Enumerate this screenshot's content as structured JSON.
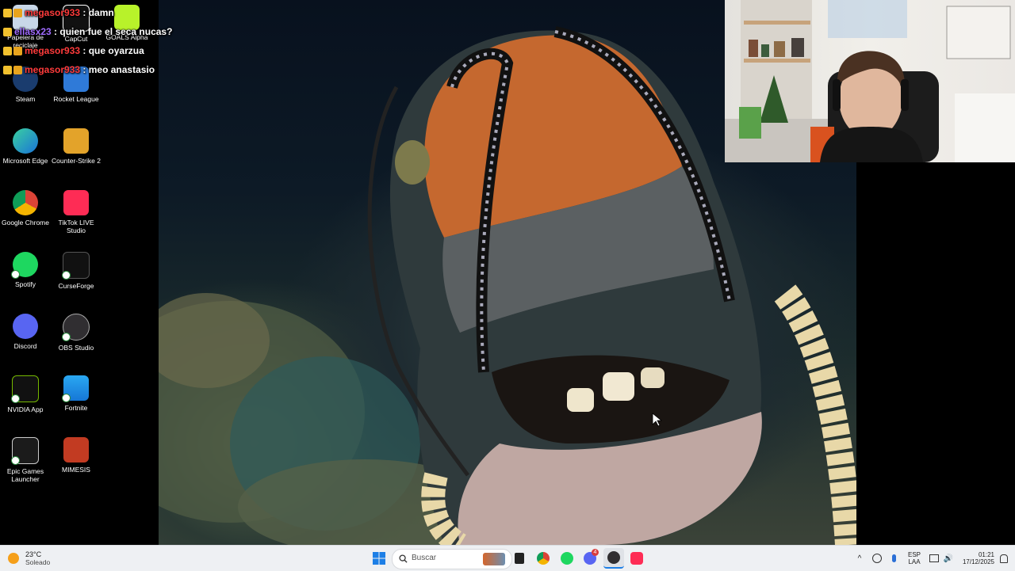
{
  "chat": [
    {
      "user": "megasor933",
      "message": "damn",
      "user_color": "#ff3b3b"
    },
    {
      "user": "ellasx23",
      "message": "quien fue el seca nucas?",
      "user_color": "#a06bff"
    },
    {
      "user": "megasor933",
      "message": "que oyarzua",
      "user_color": "#ff3b3b"
    },
    {
      "user": "megasor933",
      "message": "meo anastasio",
      "user_color": "#ff3b3b"
    }
  ],
  "desktop_icons": [
    {
      "label": "Papelera de reciclaje",
      "icon": "recycle-bin-icon"
    },
    {
      "label": "CapCut",
      "icon": "capcut-icon"
    },
    {
      "label": "GOALS Alpha",
      "icon": "goals-icon"
    },
    {
      "label": "Steam",
      "icon": "steam-icon"
    },
    {
      "label": "Rocket League",
      "icon": "rocket-league-icon"
    },
    {
      "label": "Microsoft Edge",
      "icon": "edge-icon"
    },
    {
      "label": "Counter-Strike 2",
      "icon": "counter-strike-icon"
    },
    {
      "label": "Google Chrome",
      "icon": "chrome-icon"
    },
    {
      "label": "TikTok LIVE Studio",
      "icon": "tiktok-icon"
    },
    {
      "label": "Spotify",
      "icon": "spotify-icon"
    },
    {
      "label": "CurseForge",
      "icon": "curseforge-icon"
    },
    {
      "label": "Discord",
      "icon": "discord-icon"
    },
    {
      "label": "OBS Studio",
      "icon": "obs-icon"
    },
    {
      "label": "NVIDIA App",
      "icon": "nvidia-icon"
    },
    {
      "label": "Fortnite",
      "icon": "fortnite-icon"
    },
    {
      "label": "Epic Games Launcher",
      "icon": "epic-games-icon"
    },
    {
      "label": "MIMESIS",
      "icon": "mimesis-icon"
    }
  ],
  "taskbar": {
    "weather": {
      "temp": "23°C",
      "desc": "Soleado"
    },
    "search_placeholder": "Buscar",
    "language": {
      "line1": "ESP",
      "line2": "LAA"
    },
    "time": "01:21",
    "date": "17/12/2025",
    "discord_badge": "4"
  }
}
